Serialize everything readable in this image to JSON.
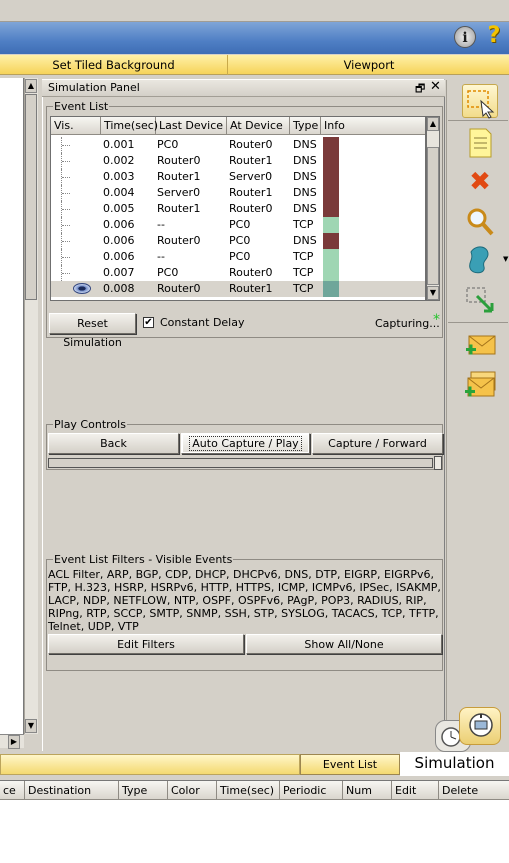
{
  "toolbar": {
    "tiled_background_label": "Set Tiled Background",
    "viewport_label": "Viewport",
    "info_glyph": "i",
    "help_glyph": "?"
  },
  "sim_panel": {
    "title": "Simulation Panel",
    "event_list_legend": "Event List",
    "columns": [
      "Vis.",
      "Time(sec)",
      "Last Device",
      "At Device",
      "Type",
      "Info"
    ],
    "events": [
      {
        "time": "0.001",
        "last": "PC0",
        "at": "Router0",
        "type": "DNS",
        "color": "#7a3a3a"
      },
      {
        "time": "0.002",
        "last": "Router0",
        "at": "Router1",
        "type": "DNS",
        "color": "#7a3a3a"
      },
      {
        "time": "0.003",
        "last": "Router1",
        "at": "Server0",
        "type": "DNS",
        "color": "#7a3a3a"
      },
      {
        "time": "0.004",
        "last": "Server0",
        "at": "Router1",
        "type": "DNS",
        "color": "#7a3a3a"
      },
      {
        "time": "0.005",
        "last": "Router1",
        "at": "Router0",
        "type": "DNS",
        "color": "#7a3a3a"
      },
      {
        "time": "0.006",
        "last": "--",
        "at": "PC0",
        "type": "TCP",
        "color": "#9fd6b3"
      },
      {
        "time": "0.006",
        "last": "Router0",
        "at": "PC0",
        "type": "DNS",
        "color": "#7a3a3a"
      },
      {
        "time": "0.006",
        "last": "--",
        "at": "PC0",
        "type": "TCP",
        "color": "#9fd6b3"
      },
      {
        "time": "0.007",
        "last": "PC0",
        "at": "Router0",
        "type": "TCP",
        "color": "#9fd6b3"
      },
      {
        "time": "0.008",
        "last": "Router0",
        "at": "Router1",
        "type": "TCP",
        "color": "#6fa69a",
        "selected": true
      }
    ],
    "reset_label": "Reset Simulation",
    "constant_delay_label": "Constant Delay",
    "constant_delay_checked": "✔",
    "capturing_label": "Capturing...",
    "capture_star": "*",
    "play_controls_legend": "Play Controls",
    "back_label": "Back",
    "auto_capture_label": "Auto Capture / Play",
    "capture_forward_label": "Capture / Forward",
    "filters_legend": "Event List Filters - Visible Events",
    "filters_text": "ACL Filter, ARP, BGP, CDP, DHCP, DHCPv6, DNS, DTP, EIGRP, EIGRPv6, FTP, H.323, HSRP, HSRPv6, HTTP, HTTPS, ICMP, ICMPv6, IPSec, ISAKMP, LACP, NDP, NETFLOW, NTP, OSPF, OSPFv6, PAgP, POP3, RADIUS, RIP, RIPng, RTP, SCCP, SMTP, SNMP, SSH, STP, SYSLOG, TACACS, TCP, TFTP, Telnet, UDP, VTP",
    "edit_filters_label": "Edit Filters",
    "show_all_label": "Show All/None"
  },
  "bottom": {
    "event_list_tab": "Event List",
    "simulation_tab": "Simulation",
    "pdu_columns": [
      "ce",
      "Destination",
      "Type",
      "Color",
      "Time(sec)",
      "Periodic",
      "Num",
      "Edit",
      "Delete"
    ]
  },
  "colors": {
    "accent_blue": "#4f7fc4",
    "gold": "#f6d35a",
    "dns_color": "#7a3a3a",
    "tcp_color": "#9fd6b3"
  }
}
